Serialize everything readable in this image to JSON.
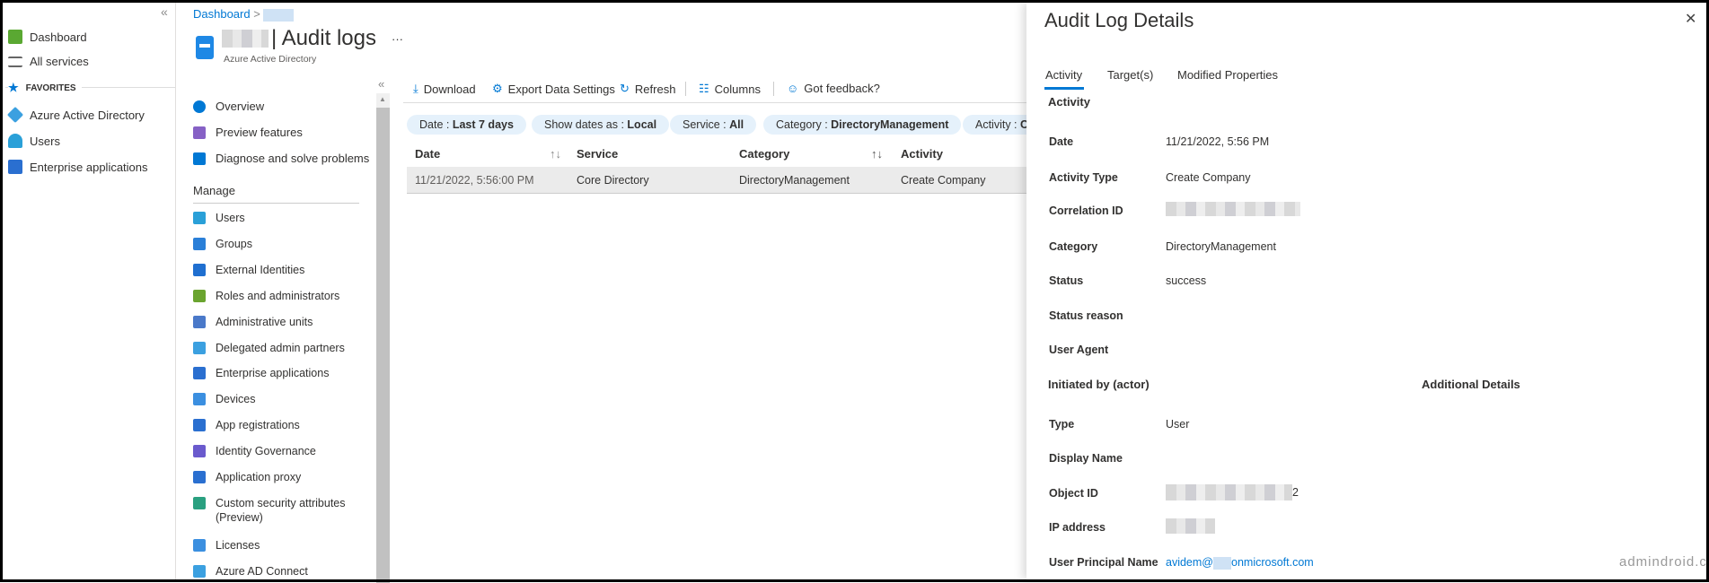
{
  "sidebar": {
    "collapse": "«",
    "items": [
      {
        "label": "Dashboard",
        "icon": "dashboard-icon"
      },
      {
        "label": "All services",
        "icon": "list-icon"
      }
    ],
    "favorites_label": "FAVORITES",
    "favorites": [
      {
        "label": "Azure Active Directory",
        "icon": "azure-ad-icon"
      },
      {
        "label": "Users",
        "icon": "user-icon"
      },
      {
        "label": "Enterprise applications",
        "icon": "enterprise-apps-icon"
      }
    ]
  },
  "header": {
    "breadcrumb": "Dashboard",
    "sep": ">",
    "title": "| Audit logs",
    "subtitle": "Azure Active Directory",
    "more": "···"
  },
  "resource_menu": {
    "collapse": "«",
    "top": [
      {
        "label": "Overview",
        "color": "#0078d4"
      },
      {
        "label": "Preview features",
        "color": "#8661c5"
      },
      {
        "label": "Diagnose and solve problems",
        "color": "#0078d4"
      }
    ],
    "section": "Manage",
    "items": [
      {
        "label": "Users",
        "color": "#2aa0d8"
      },
      {
        "label": "Groups",
        "color": "#2a7fd8"
      },
      {
        "label": "External Identities",
        "color": "#1f6fd0"
      },
      {
        "label": "Roles and administrators",
        "color": "#6aa42f"
      },
      {
        "label": "Administrative units",
        "color": "#4a79c9"
      },
      {
        "label": "Delegated admin partners",
        "color": "#3ba0e0"
      },
      {
        "label": "Enterprise applications",
        "color": "#2a6fd0"
      },
      {
        "label": "Devices",
        "color": "#3b8fe0"
      },
      {
        "label": "App registrations",
        "color": "#2a6fd0"
      },
      {
        "label": "Identity Governance",
        "color": "#6a5acd"
      },
      {
        "label": "Application proxy",
        "color": "#2a6fd0"
      },
      {
        "label": "Custom security attributes",
        "label2": "(Preview)",
        "color": "#2aa080"
      },
      {
        "label": "Licenses",
        "color": "#3b8fe0"
      },
      {
        "label": "Azure AD Connect",
        "color": "#3ba0e0"
      }
    ]
  },
  "toolbar": {
    "download": "Download",
    "export": "Export Data Settings",
    "refresh": "Refresh",
    "columns": "Columns",
    "feedback": "Got feedback?"
  },
  "filters": [
    {
      "k": "Date : ",
      "v": "Last 7 days"
    },
    {
      "k": "Show dates as : ",
      "v": "Local"
    },
    {
      "k": "Service : ",
      "v": "All"
    },
    {
      "k": "Category : ",
      "v": "DirectoryManagement"
    },
    {
      "k": "Activity : ",
      "v": "Cr"
    }
  ],
  "table": {
    "headers": [
      "Date",
      "Service",
      "Category",
      "Activity"
    ],
    "sort": "↑↓",
    "rows": [
      [
        "11/21/2022, 5:56:00 PM",
        "Core Directory",
        "DirectoryManagement",
        "Create Company"
      ]
    ]
  },
  "details": {
    "title": "Audit Log Details",
    "close": "✕",
    "tabs": [
      "Activity",
      "Target(s)",
      "Modified Properties"
    ],
    "section": "Activity",
    "fields": [
      {
        "label": "Date",
        "value": "11/21/2022, 5:56 PM"
      },
      {
        "label": "Activity Type",
        "value": "Create Company"
      },
      {
        "label": "Correlation ID",
        "value": ""
      },
      {
        "label": "Category",
        "value": "DirectoryManagement"
      },
      {
        "label": "Status",
        "value": "success"
      },
      {
        "label": "Status reason",
        "value": ""
      },
      {
        "label": "User Agent",
        "value": ""
      }
    ],
    "initiated_by": "Initiated by (actor)",
    "additional": "Additional Details",
    "actor": [
      {
        "label": "Type",
        "value": "User"
      },
      {
        "label": "Display Name",
        "value": ""
      },
      {
        "label": "Object ID",
        "value": "2"
      },
      {
        "label": "IP address",
        "value": ""
      },
      {
        "label": "User Principal Name",
        "value": "avidem@",
        "value2": "onmicrosoft.com"
      }
    ]
  },
  "watermark": "admindroid.com"
}
